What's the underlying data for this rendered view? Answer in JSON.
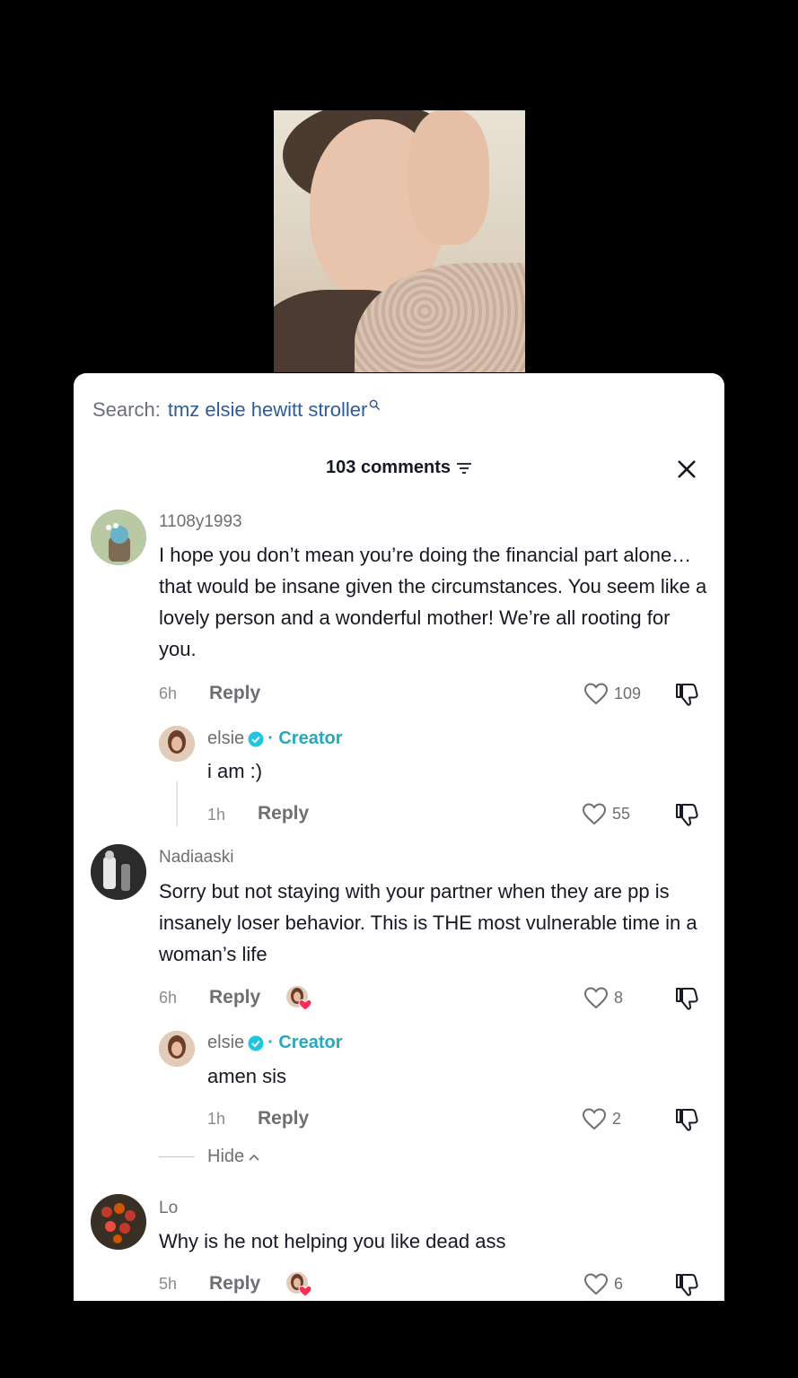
{
  "search": {
    "label": "Search:",
    "query": "tmz elsie hewitt stroller"
  },
  "header": {
    "comment_count": "103 comments"
  },
  "comments": [
    {
      "username": "1108y1993",
      "text": "I hope you don’t mean you’re doing the financial part alone… that would be insane given the circumstances. You seem like a lovely person and a wonderful mother! We’re all rooting for you.",
      "time": "6h",
      "reply": "Reply",
      "likes": "109",
      "reply_item": {
        "username": "elsie",
        "badge": "· Creator",
        "text": "i am :)",
        "time": "1h",
        "reply": "Reply",
        "likes": "55"
      }
    },
    {
      "username": "Nadiaaski",
      "text": "Sorry but not staying with your partner when they are pp is insanely loser behavior. This is THE most vulnerable time in a woman’s life",
      "time": "6h",
      "reply": "Reply",
      "likes": "8",
      "reply_item": {
        "username": "elsie",
        "badge": "· Creator",
        "text": "amen sis",
        "time": "1h",
        "reply": "Reply",
        "likes": "2"
      },
      "hide": "Hide"
    },
    {
      "username": "Lo",
      "text": "Why is he not helping you like dead ass",
      "time": "5h",
      "reply": "Reply",
      "likes": "6"
    }
  ],
  "colors": {
    "creator": "#2aa7b8",
    "search_query": "#2f5b9a",
    "liked_heart": "#fe2c55"
  }
}
